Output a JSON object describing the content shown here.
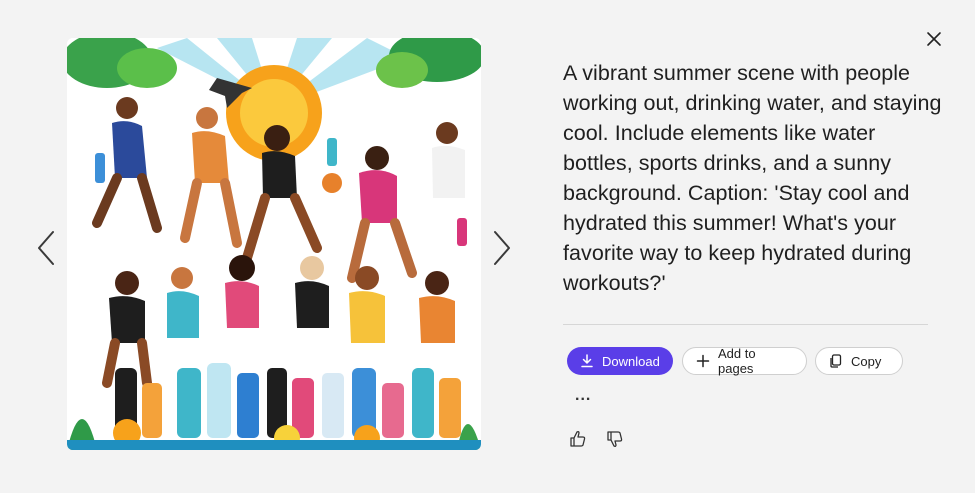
{
  "viewer": {
    "close_icon": "close-icon",
    "prev_icon": "chevron-left-icon",
    "next_icon": "chevron-right-icon",
    "image_description": "Illustration of people running and drinking water in a sunny setting"
  },
  "prompt": {
    "text": "A vibrant summer scene with people working out, drinking water, and staying cool. Include elements like water bottles, sports drinks, and a sunny background. Caption: 'Stay cool and hydrated this summer! What's your favorite way to keep hydrated during workouts?'"
  },
  "actions": {
    "download_label": "Download",
    "add_to_pages_label": "Add to pages",
    "copy_label": "Copy",
    "more_label": "..."
  },
  "feedback": {
    "like_icon": "thumbs-up-icon",
    "dislike_icon": "thumbs-down-icon"
  },
  "colors": {
    "accent": "#5a3ee8",
    "background": "#f3f3f3"
  }
}
